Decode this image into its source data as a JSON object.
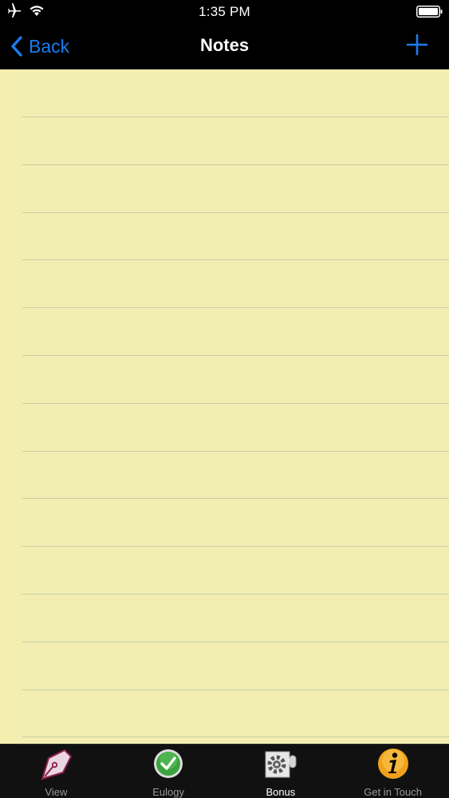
{
  "status_bar": {
    "time": "1:35 PM"
  },
  "nav": {
    "back_label": "Back",
    "title": "Notes"
  },
  "note": {
    "text": ""
  },
  "tabs": [
    {
      "label": "View",
      "icon": "pen-nib-icon",
      "active": false
    },
    {
      "label": "Eulogy",
      "icon": "checkmark-icon",
      "active": false
    },
    {
      "label": "Bonus",
      "icon": "gear-puzzle-icon",
      "active": true
    },
    {
      "label": "Get in Touch",
      "icon": "info-icon",
      "active": false
    }
  ],
  "colors": {
    "accent": "#1a7cf0",
    "paper": "#f2eeb2",
    "rule": "#c6cfa2",
    "bar_background": "#000000"
  }
}
